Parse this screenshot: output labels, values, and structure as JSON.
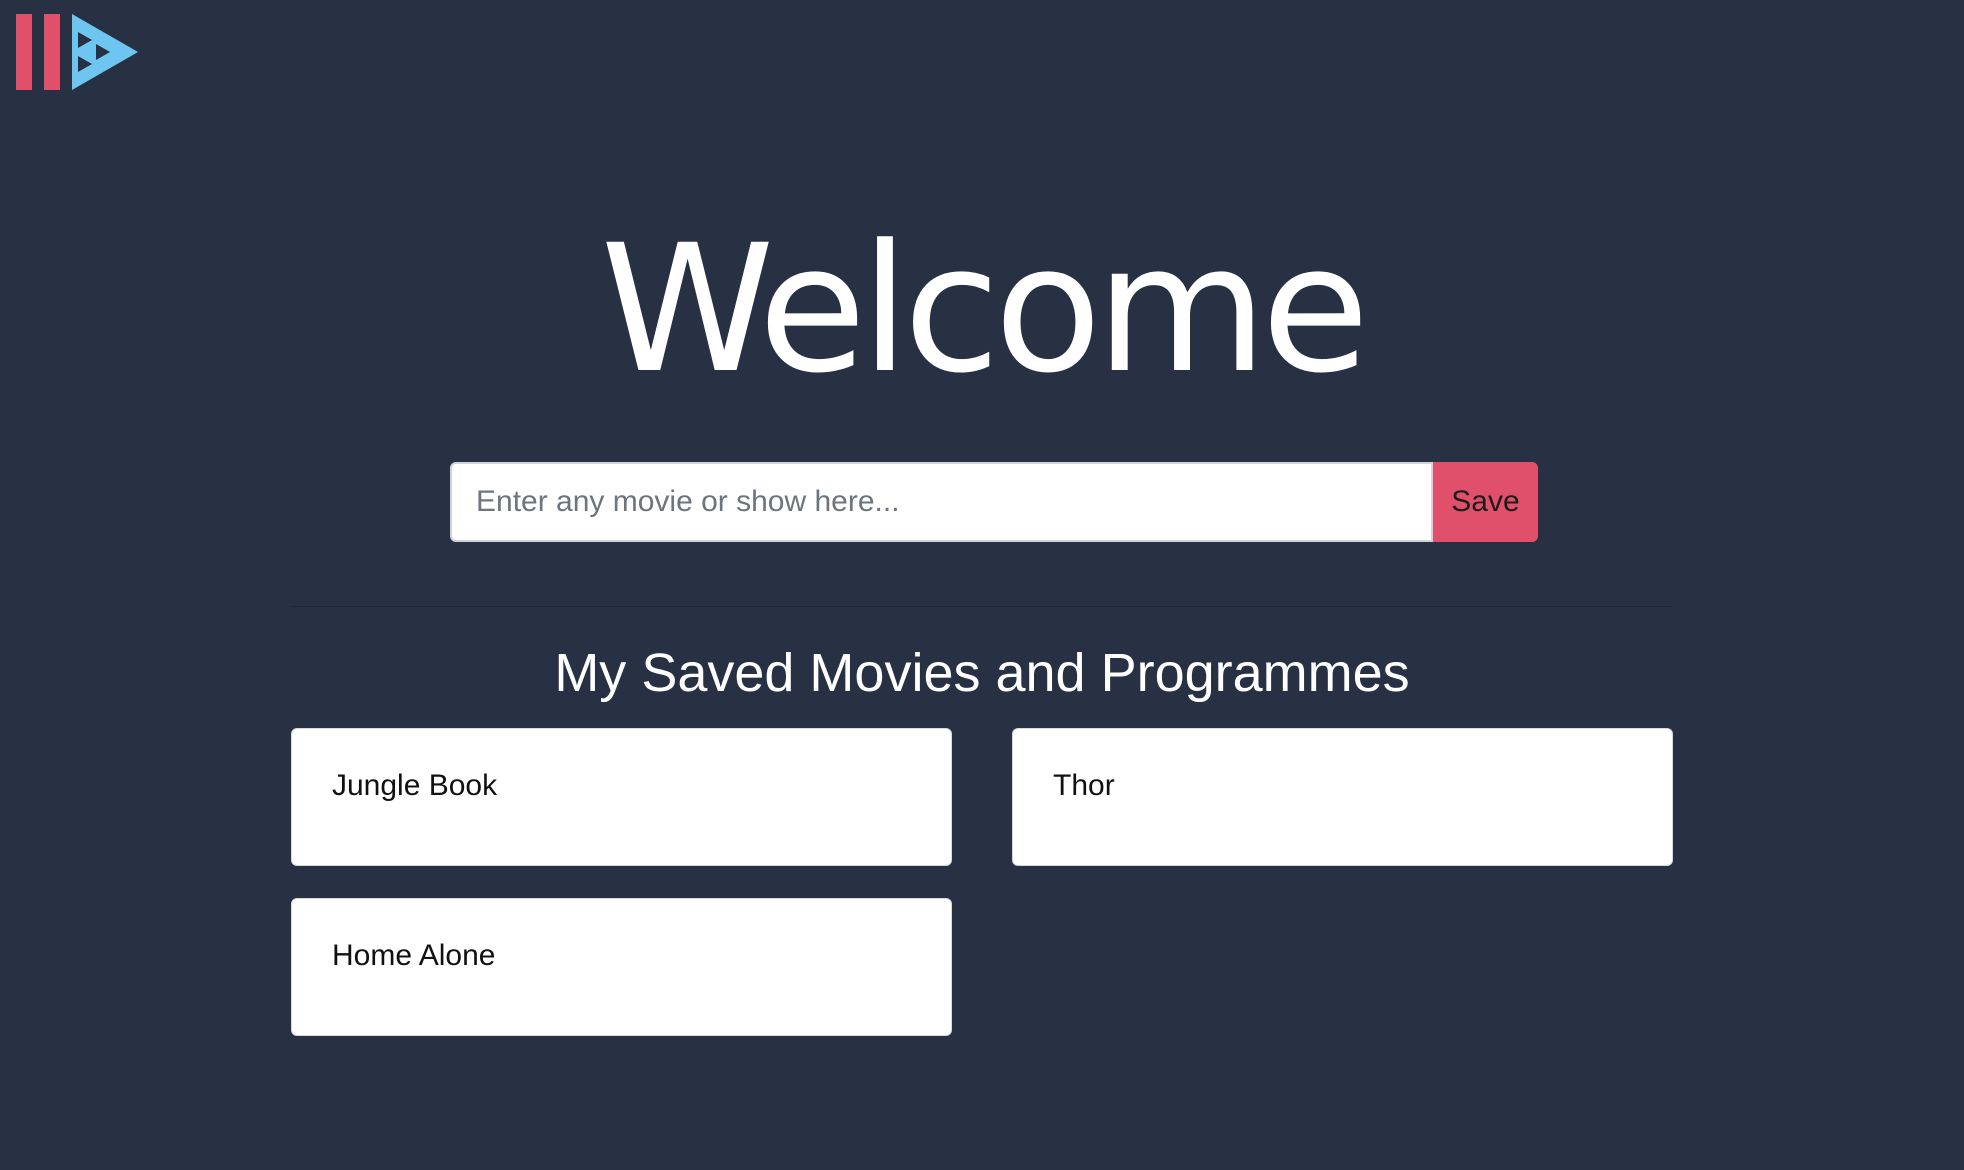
{
  "logo": {
    "icon": "play-pause-logo-icon",
    "colors": {
      "bars": "#e0506a",
      "triangle": "#6ec6f0",
      "inner": "#283044"
    }
  },
  "hero": {
    "title": "Welcome"
  },
  "search": {
    "placeholder": "Enter any movie or show here...",
    "value": "",
    "save_label": "Save"
  },
  "saved": {
    "heading": "My Saved Movies and Programmes",
    "items": [
      {
        "title": "Jungle Book"
      },
      {
        "title": "Thor"
      },
      {
        "title": "Home Alone"
      }
    ]
  },
  "colors": {
    "background": "#283044",
    "accent": "#e0506a",
    "card": "#ffffff"
  }
}
